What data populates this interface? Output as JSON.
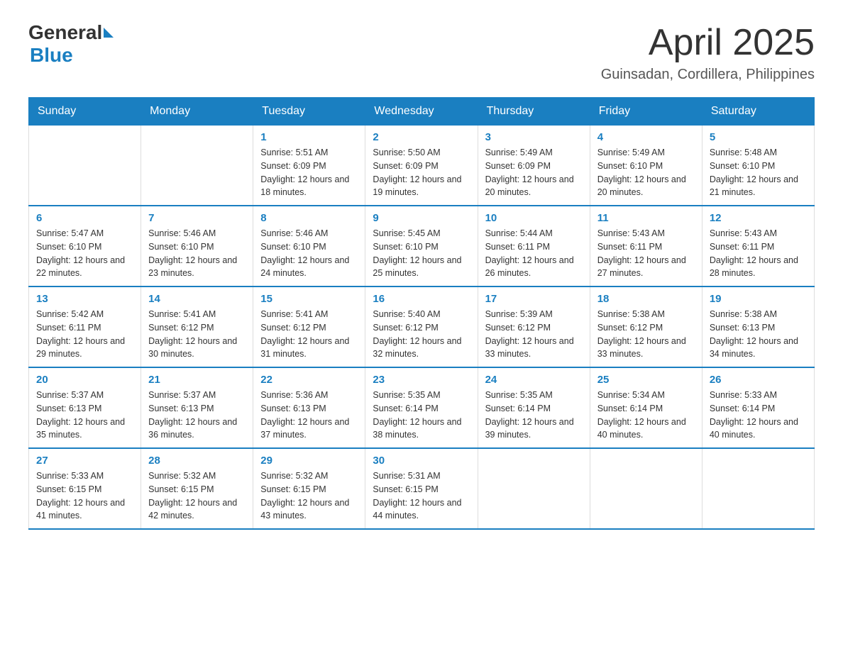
{
  "header": {
    "logo_general": "General",
    "logo_blue": "Blue",
    "month_title": "April 2025",
    "location": "Guinsadan, Cordillera, Philippines"
  },
  "weekdays": [
    "Sunday",
    "Monday",
    "Tuesday",
    "Wednesday",
    "Thursday",
    "Friday",
    "Saturday"
  ],
  "weeks": [
    [
      {
        "day": "",
        "sunrise": "",
        "sunset": "",
        "daylight": ""
      },
      {
        "day": "",
        "sunrise": "",
        "sunset": "",
        "daylight": ""
      },
      {
        "day": "1",
        "sunrise": "Sunrise: 5:51 AM",
        "sunset": "Sunset: 6:09 PM",
        "daylight": "Daylight: 12 hours and 18 minutes."
      },
      {
        "day": "2",
        "sunrise": "Sunrise: 5:50 AM",
        "sunset": "Sunset: 6:09 PM",
        "daylight": "Daylight: 12 hours and 19 minutes."
      },
      {
        "day": "3",
        "sunrise": "Sunrise: 5:49 AM",
        "sunset": "Sunset: 6:09 PM",
        "daylight": "Daylight: 12 hours and 20 minutes."
      },
      {
        "day": "4",
        "sunrise": "Sunrise: 5:49 AM",
        "sunset": "Sunset: 6:10 PM",
        "daylight": "Daylight: 12 hours and 20 minutes."
      },
      {
        "day": "5",
        "sunrise": "Sunrise: 5:48 AM",
        "sunset": "Sunset: 6:10 PM",
        "daylight": "Daylight: 12 hours and 21 minutes."
      }
    ],
    [
      {
        "day": "6",
        "sunrise": "Sunrise: 5:47 AM",
        "sunset": "Sunset: 6:10 PM",
        "daylight": "Daylight: 12 hours and 22 minutes."
      },
      {
        "day": "7",
        "sunrise": "Sunrise: 5:46 AM",
        "sunset": "Sunset: 6:10 PM",
        "daylight": "Daylight: 12 hours and 23 minutes."
      },
      {
        "day": "8",
        "sunrise": "Sunrise: 5:46 AM",
        "sunset": "Sunset: 6:10 PM",
        "daylight": "Daylight: 12 hours and 24 minutes."
      },
      {
        "day": "9",
        "sunrise": "Sunrise: 5:45 AM",
        "sunset": "Sunset: 6:10 PM",
        "daylight": "Daylight: 12 hours and 25 minutes."
      },
      {
        "day": "10",
        "sunrise": "Sunrise: 5:44 AM",
        "sunset": "Sunset: 6:11 PM",
        "daylight": "Daylight: 12 hours and 26 minutes."
      },
      {
        "day": "11",
        "sunrise": "Sunrise: 5:43 AM",
        "sunset": "Sunset: 6:11 PM",
        "daylight": "Daylight: 12 hours and 27 minutes."
      },
      {
        "day": "12",
        "sunrise": "Sunrise: 5:43 AM",
        "sunset": "Sunset: 6:11 PM",
        "daylight": "Daylight: 12 hours and 28 minutes."
      }
    ],
    [
      {
        "day": "13",
        "sunrise": "Sunrise: 5:42 AM",
        "sunset": "Sunset: 6:11 PM",
        "daylight": "Daylight: 12 hours and 29 minutes."
      },
      {
        "day": "14",
        "sunrise": "Sunrise: 5:41 AM",
        "sunset": "Sunset: 6:12 PM",
        "daylight": "Daylight: 12 hours and 30 minutes."
      },
      {
        "day": "15",
        "sunrise": "Sunrise: 5:41 AM",
        "sunset": "Sunset: 6:12 PM",
        "daylight": "Daylight: 12 hours and 31 minutes."
      },
      {
        "day": "16",
        "sunrise": "Sunrise: 5:40 AM",
        "sunset": "Sunset: 6:12 PM",
        "daylight": "Daylight: 12 hours and 32 minutes."
      },
      {
        "day": "17",
        "sunrise": "Sunrise: 5:39 AM",
        "sunset": "Sunset: 6:12 PM",
        "daylight": "Daylight: 12 hours and 33 minutes."
      },
      {
        "day": "18",
        "sunrise": "Sunrise: 5:38 AM",
        "sunset": "Sunset: 6:12 PM",
        "daylight": "Daylight: 12 hours and 33 minutes."
      },
      {
        "day": "19",
        "sunrise": "Sunrise: 5:38 AM",
        "sunset": "Sunset: 6:13 PM",
        "daylight": "Daylight: 12 hours and 34 minutes."
      }
    ],
    [
      {
        "day": "20",
        "sunrise": "Sunrise: 5:37 AM",
        "sunset": "Sunset: 6:13 PM",
        "daylight": "Daylight: 12 hours and 35 minutes."
      },
      {
        "day": "21",
        "sunrise": "Sunrise: 5:37 AM",
        "sunset": "Sunset: 6:13 PM",
        "daylight": "Daylight: 12 hours and 36 minutes."
      },
      {
        "day": "22",
        "sunrise": "Sunrise: 5:36 AM",
        "sunset": "Sunset: 6:13 PM",
        "daylight": "Daylight: 12 hours and 37 minutes."
      },
      {
        "day": "23",
        "sunrise": "Sunrise: 5:35 AM",
        "sunset": "Sunset: 6:14 PM",
        "daylight": "Daylight: 12 hours and 38 minutes."
      },
      {
        "day": "24",
        "sunrise": "Sunrise: 5:35 AM",
        "sunset": "Sunset: 6:14 PM",
        "daylight": "Daylight: 12 hours and 39 minutes."
      },
      {
        "day": "25",
        "sunrise": "Sunrise: 5:34 AM",
        "sunset": "Sunset: 6:14 PM",
        "daylight": "Daylight: 12 hours and 40 minutes."
      },
      {
        "day": "26",
        "sunrise": "Sunrise: 5:33 AM",
        "sunset": "Sunset: 6:14 PM",
        "daylight": "Daylight: 12 hours and 40 minutes."
      }
    ],
    [
      {
        "day": "27",
        "sunrise": "Sunrise: 5:33 AM",
        "sunset": "Sunset: 6:15 PM",
        "daylight": "Daylight: 12 hours and 41 minutes."
      },
      {
        "day": "28",
        "sunrise": "Sunrise: 5:32 AM",
        "sunset": "Sunset: 6:15 PM",
        "daylight": "Daylight: 12 hours and 42 minutes."
      },
      {
        "day": "29",
        "sunrise": "Sunrise: 5:32 AM",
        "sunset": "Sunset: 6:15 PM",
        "daylight": "Daylight: 12 hours and 43 minutes."
      },
      {
        "day": "30",
        "sunrise": "Sunrise: 5:31 AM",
        "sunset": "Sunset: 6:15 PM",
        "daylight": "Daylight: 12 hours and 44 minutes."
      },
      {
        "day": "",
        "sunrise": "",
        "sunset": "",
        "daylight": ""
      },
      {
        "day": "",
        "sunrise": "",
        "sunset": "",
        "daylight": ""
      },
      {
        "day": "",
        "sunrise": "",
        "sunset": "",
        "daylight": ""
      }
    ]
  ]
}
